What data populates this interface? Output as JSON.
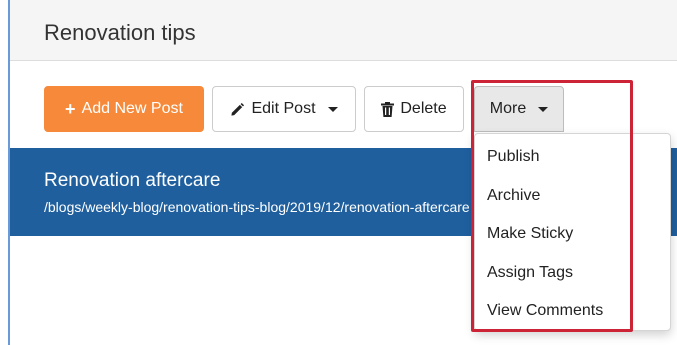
{
  "panel": {
    "title": "Renovation tips"
  },
  "toolbar": {
    "add_label": "Add New Post",
    "edit_label": "Edit Post",
    "delete_label": "Delete",
    "more_label": "More"
  },
  "post": {
    "title": "Renovation aftercare",
    "url": "/blogs/weekly-blog/renovation-tips-blog/2019/12/renovation-aftercare"
  },
  "more_menu": {
    "items": [
      {
        "label": "Publish"
      },
      {
        "label": "Archive"
      },
      {
        "label": "Make Sticky"
      },
      {
        "label": "Assign Tags"
      },
      {
        "label": "View Comments"
      }
    ]
  },
  "icons": {
    "add": "plus-icon",
    "edit": "pencil-icon",
    "delete": "trash-icon",
    "dropdown": "caret-down-icon"
  },
  "colors": {
    "accent_orange": "#f68a3a",
    "selected_row": "#1f5f9e",
    "highlight": "#cc2336"
  }
}
